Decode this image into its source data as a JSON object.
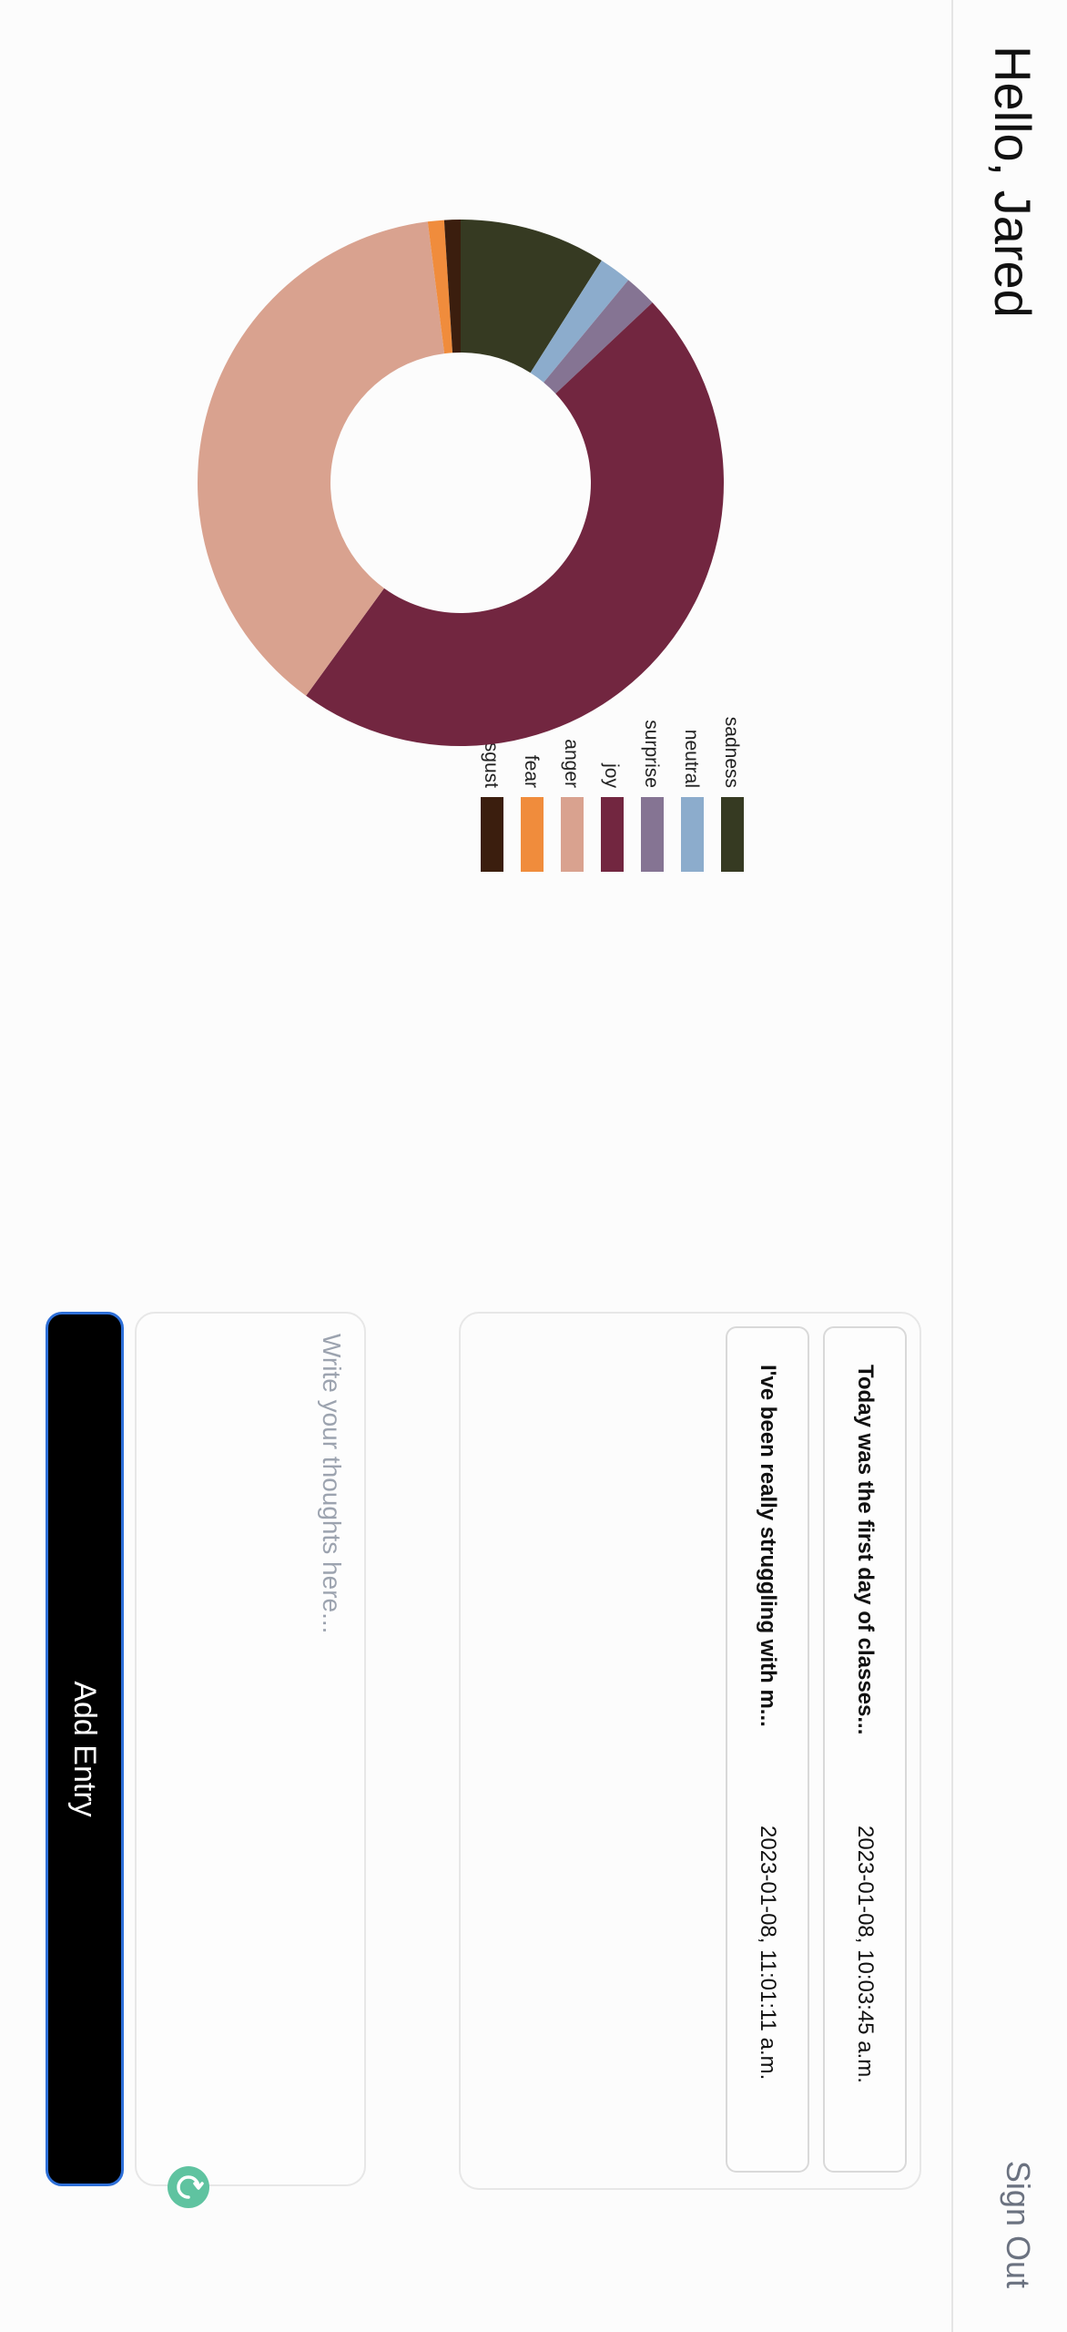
{
  "header": {
    "greeting": "Hello, Jared",
    "sign_out": "Sign Out"
  },
  "entries": [
    {
      "title": "Today was the first day of classes...",
      "timestamp": "2023-01-08, 10:03:45 a.m."
    },
    {
      "title": "I've been really struggling with m...",
      "timestamp": "2023-01-08, 11:01:11 a.m."
    }
  ],
  "editor": {
    "placeholder": "Write your thoughts here...",
    "value": "",
    "refresh_icon": "refresh-icon",
    "add_entry_label": "Add Entry"
  },
  "chart_data": {
    "type": "pie",
    "categories": [
      "sadness",
      "neutral",
      "surprise",
      "joy",
      "anger",
      "fear",
      "disgust"
    ],
    "values": [
      9,
      2,
      2,
      47,
      38,
      1,
      1
    ],
    "colors": [
      "#363a22",
      "#8caccc",
      "#857493",
      "#722640",
      "#d9a28f",
      "#f08c3c",
      "#3b1e0e"
    ],
    "legend": {
      "placement": "top"
    }
  }
}
